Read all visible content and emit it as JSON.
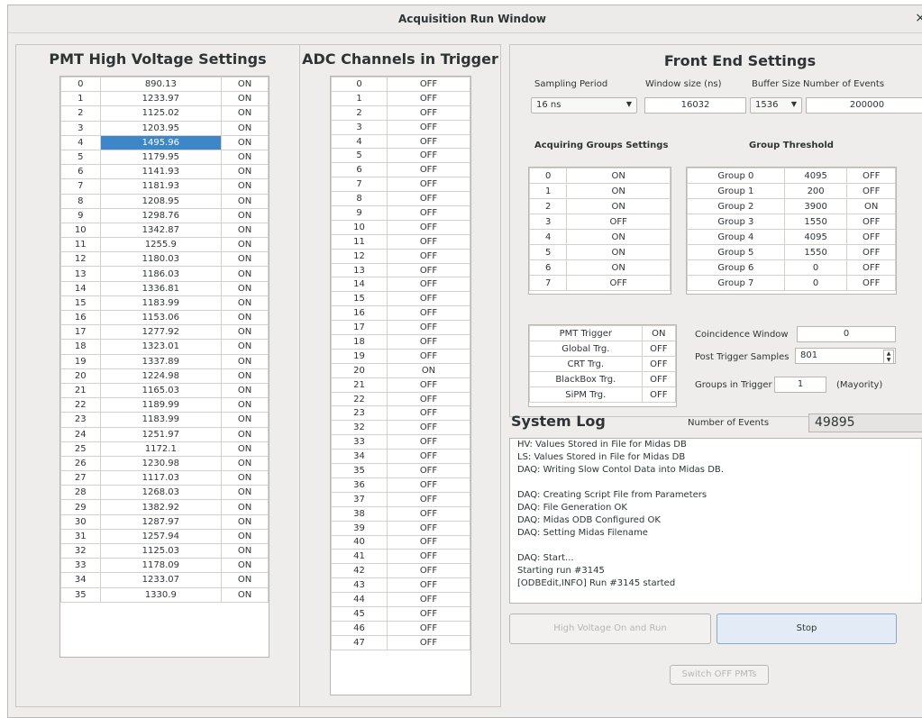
{
  "window": {
    "title": "Acquisition Run Window",
    "close_glyph": "×"
  },
  "hv": {
    "title": "PMT High Voltage Settings",
    "rows": [
      [
        "0",
        "890.13",
        "ON"
      ],
      [
        "1",
        "1233.97",
        "ON"
      ],
      [
        "2",
        "1125.02",
        "ON"
      ],
      [
        "3",
        "1203.95",
        "ON"
      ],
      [
        "4",
        "1495.96",
        "ON"
      ],
      [
        "5",
        "1179.95",
        "ON"
      ],
      [
        "6",
        "1141.93",
        "ON"
      ],
      [
        "7",
        "1181.93",
        "ON"
      ],
      [
        "8",
        "1208.95",
        "ON"
      ],
      [
        "9",
        "1298.76",
        "ON"
      ],
      [
        "10",
        "1342.87",
        "ON"
      ],
      [
        "11",
        "1255.9",
        "ON"
      ],
      [
        "12",
        "1180.03",
        "ON"
      ],
      [
        "13",
        "1186.03",
        "ON"
      ],
      [
        "14",
        "1336.81",
        "ON"
      ],
      [
        "15",
        "1183.99",
        "ON"
      ],
      [
        "16",
        "1153.06",
        "ON"
      ],
      [
        "17",
        "1277.92",
        "ON"
      ],
      [
        "18",
        "1323.01",
        "ON"
      ],
      [
        "19",
        "1337.89",
        "ON"
      ],
      [
        "20",
        "1224.98",
        "ON"
      ],
      [
        "21",
        "1165.03",
        "ON"
      ],
      [
        "22",
        "1189.99",
        "ON"
      ],
      [
        "23",
        "1183.99",
        "ON"
      ],
      [
        "24",
        "1251.97",
        "ON"
      ],
      [
        "25",
        "1172.1",
        "ON"
      ],
      [
        "26",
        "1230.98",
        "ON"
      ],
      [
        "27",
        "1117.03",
        "ON"
      ],
      [
        "28",
        "1268.03",
        "ON"
      ],
      [
        "29",
        "1382.92",
        "ON"
      ],
      [
        "30",
        "1287.97",
        "ON"
      ],
      [
        "31",
        "1257.94",
        "ON"
      ],
      [
        "32",
        "1125.03",
        "ON"
      ],
      [
        "33",
        "1178.09",
        "ON"
      ],
      [
        "34",
        "1233.07",
        "ON"
      ],
      [
        "35",
        "1330.9",
        "ON"
      ]
    ]
  },
  "adc": {
    "title": "ADC Channels in Trigger",
    "rows": [
      [
        "0",
        "OFF"
      ],
      [
        "1",
        "OFF"
      ],
      [
        "2",
        "OFF"
      ],
      [
        "3",
        "OFF"
      ],
      [
        "4",
        "OFF"
      ],
      [
        "5",
        "OFF"
      ],
      [
        "6",
        "OFF"
      ],
      [
        "7",
        "OFF"
      ],
      [
        "8",
        "OFF"
      ],
      [
        "9",
        "OFF"
      ],
      [
        "10",
        "OFF"
      ],
      [
        "11",
        "OFF"
      ],
      [
        "12",
        "OFF"
      ],
      [
        "13",
        "OFF"
      ],
      [
        "14",
        "OFF"
      ],
      [
        "15",
        "OFF"
      ],
      [
        "16",
        "OFF"
      ],
      [
        "17",
        "OFF"
      ],
      [
        "18",
        "OFF"
      ],
      [
        "19",
        "OFF"
      ],
      [
        "20",
        "ON"
      ],
      [
        "21",
        "OFF"
      ],
      [
        "22",
        "OFF"
      ],
      [
        "23",
        "OFF"
      ],
      [
        "32",
        "OFF"
      ],
      [
        "33",
        "OFF"
      ],
      [
        "34",
        "OFF"
      ],
      [
        "35",
        "OFF"
      ],
      [
        "36",
        "OFF"
      ],
      [
        "37",
        "OFF"
      ],
      [
        "38",
        "OFF"
      ],
      [
        "39",
        "OFF"
      ],
      [
        "40",
        "OFF"
      ],
      [
        "41",
        "OFF"
      ],
      [
        "42",
        "OFF"
      ],
      [
        "43",
        "OFF"
      ],
      [
        "44",
        "OFF"
      ],
      [
        "45",
        "OFF"
      ],
      [
        "46",
        "OFF"
      ],
      [
        "47",
        "OFF"
      ]
    ]
  },
  "fe": {
    "title": "Front End Settings",
    "sampling_label": "Sampling Period",
    "sampling_value": "16 ns",
    "window_label": "Window size (ns)",
    "window_value": "16032",
    "buffer_label": "Buffer Size",
    "buffer_value": "1536",
    "nevents_label": "Number of Events",
    "nevents_value": "200000",
    "groups_title": "Acquiring Groups Settings",
    "thresh_title": "Group Threshold",
    "groups": [
      [
        "0",
        "ON"
      ],
      [
        "1",
        "ON"
      ],
      [
        "2",
        "ON"
      ],
      [
        "3",
        "OFF"
      ],
      [
        "4",
        "ON"
      ],
      [
        "5",
        "ON"
      ],
      [
        "6",
        "ON"
      ],
      [
        "7",
        "OFF"
      ]
    ],
    "thresholds": [
      [
        "Group 0",
        "4095",
        "OFF"
      ],
      [
        "Group 1",
        "200",
        "OFF"
      ],
      [
        "Group 2",
        "3900",
        "ON"
      ],
      [
        "Group 3",
        "1550",
        "OFF"
      ],
      [
        "Group 4",
        "4095",
        "OFF"
      ],
      [
        "Group 5",
        "1550",
        "OFF"
      ],
      [
        "Group 6",
        "0",
        "OFF"
      ],
      [
        "Group 7",
        "0",
        "OFF"
      ]
    ],
    "triggers": [
      [
        "PMT Trigger",
        "ON"
      ],
      [
        "Global Trg.",
        "OFF"
      ],
      [
        "CRT Trg.",
        "OFF"
      ],
      [
        "BlackBox Trg.",
        "OFF"
      ],
      [
        "SiPM Trg.",
        "OFF"
      ]
    ],
    "coinc_label": "Coincidence Window",
    "coinc_value": "0",
    "post_label": "Post Trigger Samples",
    "post_value": "801",
    "git_label": "Groups in Trigger",
    "git_value": "1",
    "git_suffix": "(Mayority)"
  },
  "syslog": {
    "title": "System Log",
    "events_label": "Number of Events",
    "events_value": "49895",
    "lines": [
      "HV: Values Stored in File for Midas DB",
      "LS: Values Stored in File for Midas DB",
      "DAQ: Writing Slow Contol Data into Midas DB.",
      "",
      "DAQ: Creating Script File from Parameters",
      "DAQ: File Generation OK",
      "DAQ: Midas ODB Configured OK",
      "DAQ: Setting Midas Filename",
      "",
      "DAQ: Start...",
      "Starting run #3145",
      "[ODBEdit,INFO] Run #3145 started"
    ]
  },
  "buttons": {
    "hv_run": "High Voltage On and Run",
    "stop": "Stop",
    "switch_off": "Switch OFF PMTs"
  }
}
